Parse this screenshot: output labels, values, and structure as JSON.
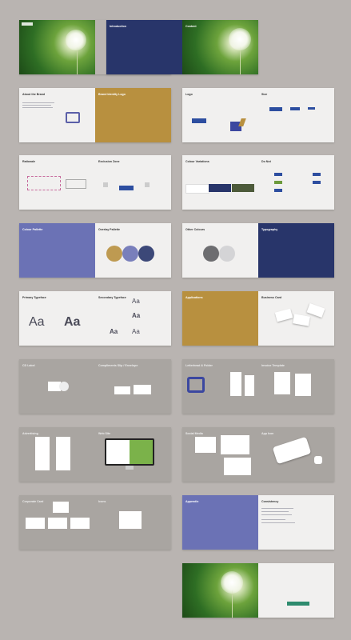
{
  "rows": [
    {
      "left": {
        "title_l": "",
        "title_r": ""
      },
      "right": {
        "title_l": "Introduction",
        "title_r": "Content"
      }
    },
    {
      "left": {
        "title_l": "About the Brand",
        "title_r": "Brand Identity Logo"
      },
      "right": {
        "title_l": "Logo",
        "title_r": "Size"
      }
    },
    {
      "left": {
        "title_l": "Rationale",
        "title_r": "Exclusion Zone"
      },
      "right": {
        "title_l": "Colour Variations",
        "title_r": "Do Not"
      }
    },
    {
      "left": {
        "title_l": "Colour Pallette",
        "title_r": "Overlay Pallette"
      },
      "right": {
        "title_l": "Other Colours",
        "title_r": "Typography"
      }
    },
    {
      "left": {
        "title_l": "Primary Typeface",
        "title_r": "Secondary Typeface"
      },
      "right": {
        "title_l": "Applications",
        "title_r": "Business Card"
      }
    },
    {
      "left": {
        "title_l": "CD Label",
        "title_r": "Compliments Slip / Envelope"
      },
      "right": {
        "title_l": "Letterhead & Folder",
        "title_r": "Invoice Template"
      }
    },
    {
      "left": {
        "title_l": "Advertising",
        "title_r": "Web Site"
      },
      "right": {
        "title_l": "Social Media",
        "title_r": "App Icon"
      }
    },
    {
      "left": {
        "title_l": "Corporate Card",
        "title_r": "Icons"
      },
      "right": {
        "title_l": "Appendix",
        "title_r": "Consistency"
      }
    },
    {
      "left": null,
      "right": {
        "title_l": "",
        "title_r": ""
      }
    }
  ],
  "typography": {
    "aa_large": "Aa",
    "aa_small": "Aa"
  }
}
